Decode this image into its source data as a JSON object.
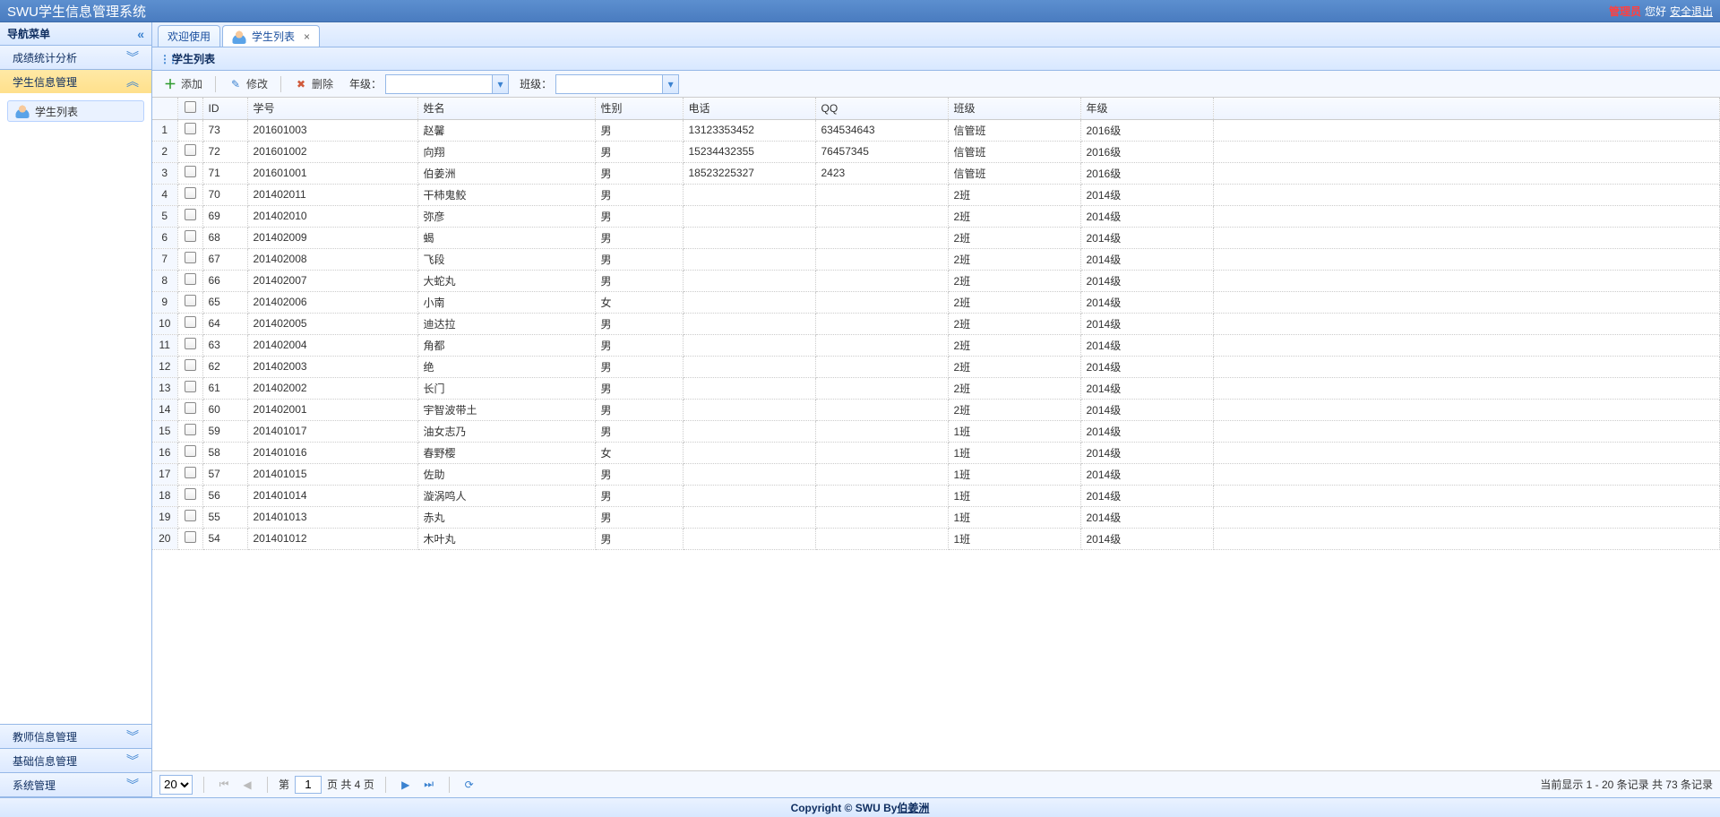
{
  "header": {
    "title": "SWU学生信息管理系统",
    "admin": "管理员",
    "greeting": "您好",
    "logout": "安全退出"
  },
  "sidebar": {
    "title": "导航菜单",
    "items": [
      {
        "label": "成绩统计分析",
        "expanded": false
      },
      {
        "label": "学生信息管理",
        "expanded": true
      },
      {
        "label": "教师信息管理",
        "expanded": false
      },
      {
        "label": "基础信息管理",
        "expanded": false
      },
      {
        "label": "系统管理",
        "expanded": false
      }
    ],
    "studentListNode": "学生列表"
  },
  "tabs": [
    {
      "label": "欢迎使用",
      "closable": false,
      "active": false
    },
    {
      "label": "学生列表",
      "closable": true,
      "active": true
    }
  ],
  "panel": {
    "title": "学生列表"
  },
  "toolbar": {
    "add": "添加",
    "edit": "修改",
    "del": "删除",
    "gradeLabel": "年级：",
    "classLabel": "班级：",
    "gradeValue": "",
    "classValue": ""
  },
  "columns": [
    "ID",
    "学号",
    "姓名",
    "性别",
    "电话",
    "QQ",
    "班级",
    "年级"
  ],
  "rows": [
    {
      "id": "73",
      "sn": "201601003",
      "name": "赵馨",
      "gender": "男",
      "phone": "13123353452",
      "qq": "634534643",
      "class": "信管班",
      "grade": "2016级"
    },
    {
      "id": "72",
      "sn": "201601002",
      "name": "向翔",
      "gender": "男",
      "phone": "15234432355",
      "qq": "76457345",
      "class": "信管班",
      "grade": "2016级"
    },
    {
      "id": "71",
      "sn": "201601001",
      "name": "伯姜洲",
      "gender": "男",
      "phone": "18523225327",
      "qq": "2423",
      "class": "信管班",
      "grade": "2016级"
    },
    {
      "id": "70",
      "sn": "201402011",
      "name": "干柿鬼鲛",
      "gender": "男",
      "phone": "",
      "qq": "",
      "class": "2班",
      "grade": "2014级"
    },
    {
      "id": "69",
      "sn": "201402010",
      "name": "弥彦",
      "gender": "男",
      "phone": "",
      "qq": "",
      "class": "2班",
      "grade": "2014级"
    },
    {
      "id": "68",
      "sn": "201402009",
      "name": "蝎",
      "gender": "男",
      "phone": "",
      "qq": "",
      "class": "2班",
      "grade": "2014级"
    },
    {
      "id": "67",
      "sn": "201402008",
      "name": "飞段",
      "gender": "男",
      "phone": "",
      "qq": "",
      "class": "2班",
      "grade": "2014级"
    },
    {
      "id": "66",
      "sn": "201402007",
      "name": "大蛇丸",
      "gender": "男",
      "phone": "",
      "qq": "",
      "class": "2班",
      "grade": "2014级"
    },
    {
      "id": "65",
      "sn": "201402006",
      "name": "小南",
      "gender": "女",
      "phone": "",
      "qq": "",
      "class": "2班",
      "grade": "2014级"
    },
    {
      "id": "64",
      "sn": "201402005",
      "name": "迪达拉",
      "gender": "男",
      "phone": "",
      "qq": "",
      "class": "2班",
      "grade": "2014级"
    },
    {
      "id": "63",
      "sn": "201402004",
      "name": "角都",
      "gender": "男",
      "phone": "",
      "qq": "",
      "class": "2班",
      "grade": "2014级"
    },
    {
      "id": "62",
      "sn": "201402003",
      "name": "绝",
      "gender": "男",
      "phone": "",
      "qq": "",
      "class": "2班",
      "grade": "2014级"
    },
    {
      "id": "61",
      "sn": "201402002",
      "name": "长门",
      "gender": "男",
      "phone": "",
      "qq": "",
      "class": "2班",
      "grade": "2014级"
    },
    {
      "id": "60",
      "sn": "201402001",
      "name": "宇智波带土",
      "gender": "男",
      "phone": "",
      "qq": "",
      "class": "2班",
      "grade": "2014级"
    },
    {
      "id": "59",
      "sn": "201401017",
      "name": "油女志乃",
      "gender": "男",
      "phone": "",
      "qq": "",
      "class": "1班",
      "grade": "2014级"
    },
    {
      "id": "58",
      "sn": "201401016",
      "name": "春野樱",
      "gender": "女",
      "phone": "",
      "qq": "",
      "class": "1班",
      "grade": "2014级"
    },
    {
      "id": "57",
      "sn": "201401015",
      "name": "佐助",
      "gender": "男",
      "phone": "",
      "qq": "",
      "class": "1班",
      "grade": "2014级"
    },
    {
      "id": "56",
      "sn": "201401014",
      "name": "漩涡鸣人",
      "gender": "男",
      "phone": "",
      "qq": "",
      "class": "1班",
      "grade": "2014级"
    },
    {
      "id": "55",
      "sn": "201401013",
      "name": "赤丸",
      "gender": "男",
      "phone": "",
      "qq": "",
      "class": "1班",
      "grade": "2014级"
    },
    {
      "id": "54",
      "sn": "201401012",
      "name": "木叶丸",
      "gender": "男",
      "phone": "",
      "qq": "",
      "class": "1班",
      "grade": "2014级"
    }
  ],
  "pager": {
    "pageSize": "20",
    "pagePrefix": "第",
    "page": "1",
    "totalPagesText": "页 共 4 页",
    "info": "当前显示 1 - 20 条记录 共 73 条记录"
  },
  "footer": {
    "text1": "Copyright © SWU By ",
    "author": "伯姜洲"
  }
}
